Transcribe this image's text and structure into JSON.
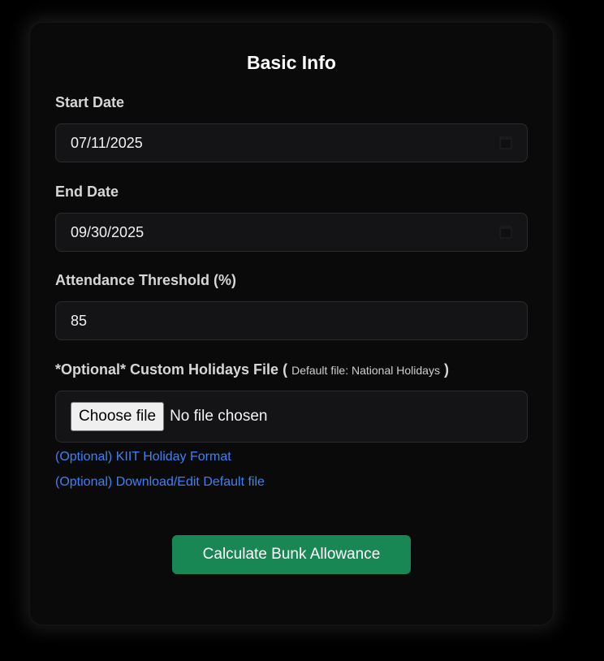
{
  "form": {
    "title": "Basic Info",
    "start_date": {
      "label": "Start Date",
      "value": "07/11/2025",
      "icon": "calendar-icon"
    },
    "end_date": {
      "label": "End Date",
      "value": "09/30/2025",
      "icon": "calendar-icon"
    },
    "threshold": {
      "label": "Attendance Threshold (%)",
      "value": "85"
    },
    "holidays": {
      "label": "*Optional* Custom Holidays File",
      "paren_open": "(",
      "hint": "Default file: National Holidays",
      "paren_close": ")",
      "choose_button": "Choose file",
      "file_status": "No file chosen"
    },
    "links": {
      "kiit_format": "(Optional) KIIT Holiday Format",
      "download_default": "(Optional) Download/Edit Default file"
    },
    "submit_label": "Calculate Bunk Allowance"
  },
  "colors": {
    "background": "#000000",
    "card": "#0a0a0b",
    "input": "#141416",
    "link": "#3b82f6",
    "submit": "#198754"
  }
}
